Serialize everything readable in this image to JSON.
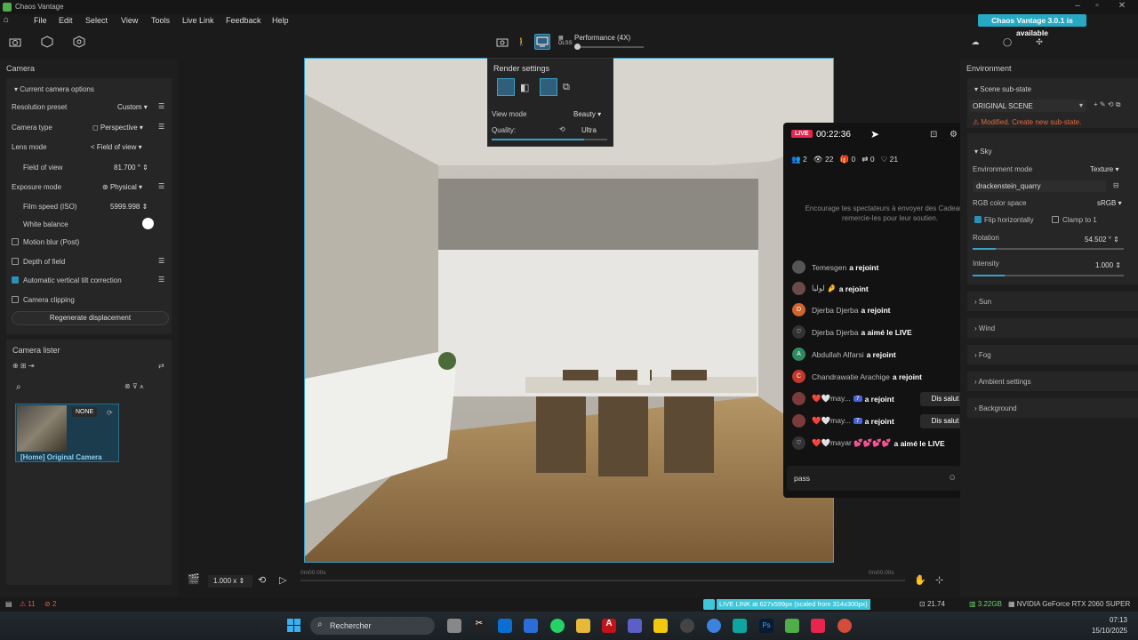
{
  "app": {
    "title": "Chaos Vantage",
    "update_badge": "Chaos Vantage 3.0.1 is available"
  },
  "menu": [
    "File",
    "Edit",
    "Select",
    "View",
    "Tools",
    "Live Link",
    "Feedback",
    "Help"
  ],
  "toolbar": {
    "perf_label": "Performance (4X)",
    "dlss_label": "DLSS"
  },
  "left_panel": {
    "camera_header": "Camera",
    "current_camera_options": "Current camera options",
    "rows": {
      "resolution_preset": {
        "label": "Resolution preset",
        "value": "Custom"
      },
      "camera_type": {
        "label": "Camera type",
        "value": "Perspective"
      },
      "lens_mode": {
        "label": "Lens mode",
        "value": "Field of view"
      },
      "field_of_view": {
        "label": "Field of view",
        "value": "81.700 °"
      },
      "exposure_mode": {
        "label": "Exposure mode",
        "value": "Physical"
      },
      "film_speed": {
        "label": "Film speed (ISO)",
        "value": "5999.998"
      },
      "white_balance": {
        "label": "White balance"
      }
    },
    "checks": {
      "motion_blur": {
        "label": "Motion blur (Post)",
        "checked": false
      },
      "depth_of_field": {
        "label": "Depth of field",
        "checked": false
      },
      "auto_tilt": {
        "label": "Automatic vertical tilt correction",
        "checked": true
      },
      "camera_clipping": {
        "label": "Camera clipping",
        "checked": false
      }
    },
    "regenerate_button": "Regenerate displacement",
    "camera_lister_header": "Camera lister",
    "camera_card": {
      "badge": "NONE",
      "name": "[Home] Original Camera"
    }
  },
  "render_settings": {
    "title": "Render settings",
    "view_mode_label": "View mode",
    "view_mode_value": "Beauty",
    "quality_label": "Quality:",
    "quality_value": "Ultra",
    "quality_level": 0.8
  },
  "tiktok": {
    "live_badge": "LIVE",
    "timer": "00:22:36",
    "stats": {
      "viewers": "2",
      "views": "22",
      "gifts": "0",
      "shares": "0",
      "likes": "21"
    },
    "encourage": "Encourage tes spectateurs à envoyer des Cadeaux et remercie-les pour leur soutien.",
    "chat": [
      {
        "name": "Temesgen",
        "action": "a rejoint",
        "avatar": "#555"
      },
      {
        "name": "لوليا 🤌",
        "action": "a rejoint",
        "avatar": "#6a4a4a"
      },
      {
        "name": "Djerba Djerba",
        "action": "a rejoint",
        "avatar": "#d0642a",
        "initial": "D"
      },
      {
        "name": "Djerba Djerba",
        "action": "a aimé le LIVE",
        "avatar": "#333",
        "initial": "♡"
      },
      {
        "name": "Abdullah Alfarsi",
        "action": "a rejoint",
        "avatar": "#2f8a60",
        "initial": "A"
      },
      {
        "name": "Chandrawatie Arachige",
        "action": "a rejoint",
        "avatar": "#c0392b",
        "initial": "C"
      },
      {
        "name": "❤️🤍may...",
        "badge": "7",
        "action": "a rejoint",
        "avatar": "#7a3b3b",
        "say": "Dis salut"
      },
      {
        "name": "❤️🤍may...",
        "badge": "7",
        "action": "a rejoint",
        "avatar": "#7a3b3b",
        "say": "Dis salut"
      },
      {
        "name": "❤️🤍mayar 💕💕💕💕",
        "action": "a aimé le LIVE",
        "avatar": "#333",
        "initial": "♡"
      }
    ],
    "input_value": "pass"
  },
  "right_panel": {
    "environment_header": "Environment",
    "scene_substate": "Scene sub-state",
    "original_scene": "ORIGINAL SCENE",
    "modified_note": "Modified. Create new sub-state.",
    "sky_header": "Sky",
    "environment_mode": {
      "label": "Environment mode",
      "value": "Texture"
    },
    "hdri_file": "drackenstein_quarry",
    "rgb_color_space": {
      "label": "RGB color space",
      "value": "sRGB"
    },
    "flip_horizontally": "Flip horizontally",
    "clamp_to_1": "Clamp to 1",
    "rotation": {
      "label": "Rotation",
      "value": "54.502 °"
    },
    "intensity": {
      "label": "Intensity",
      "value": "1.000"
    },
    "sections": [
      "Sun",
      "Wind",
      "Fog",
      "Ambient settings",
      "Background"
    ]
  },
  "timeline": {
    "speed": "1.000 x",
    "time_start": "0m00.00s",
    "time_end": "0m00.00s"
  },
  "status": {
    "warnings": "11",
    "errors": "2",
    "live_link": "LIVE LINK at 627x599px (scaled from 314x300px)",
    "fps": "21.74",
    "vram": "3.22GB",
    "gpu": "NVIDIA GeForce RTX 2060 SUPER"
  },
  "taskbar": {
    "search_placeholder": "Rechercher",
    "time": "07:13",
    "date": "15/10/2025"
  }
}
